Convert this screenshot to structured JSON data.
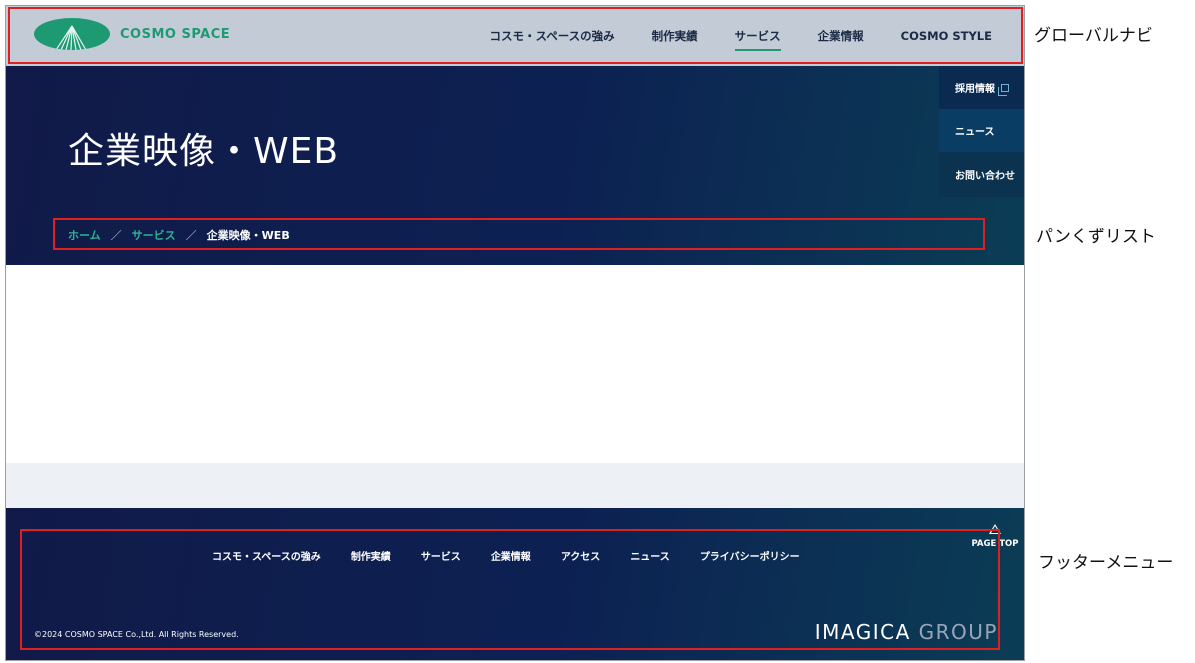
{
  "header": {
    "logo_text": "COSMO SPACE",
    "nav": [
      {
        "label": "コスモ・スペースの強み"
      },
      {
        "label": "制作実績"
      },
      {
        "label": "サービス",
        "active": true
      },
      {
        "label": "企業情報"
      },
      {
        "label": "COSMO STYLE"
      }
    ]
  },
  "hero": {
    "title": "企業映像・WEB",
    "side_tabs": {
      "recruit": "採用情報",
      "news": "ニュース",
      "contact": "お問い合わせ"
    },
    "breadcrumb": {
      "home": "ホーム",
      "service": "サービス",
      "current": "企業映像・WEB",
      "separator": "／"
    }
  },
  "footer": {
    "links": [
      "コスモ・スペースの強み",
      "制作実績",
      "サービス",
      "企業情報",
      "アクセス",
      "ニュース",
      "プライバシーポリシー"
    ],
    "page_top": "PAGE TOP",
    "copyright": "©2024 COSMO SPACE Co.,Ltd. All Rights Reserved.",
    "group_logo_1": "IMAGICA",
    "group_logo_2": "GROUP"
  },
  "annotations": {
    "global_nav": "グローバルナビ",
    "breadcrumb": "パンくずリスト",
    "footer_menu": "フッターメニュー"
  },
  "colors": {
    "accent": "#1e9a73",
    "header_bg": "#c3cbd6",
    "hero_dark": "#111a48",
    "annotation_red": "#e02020"
  }
}
